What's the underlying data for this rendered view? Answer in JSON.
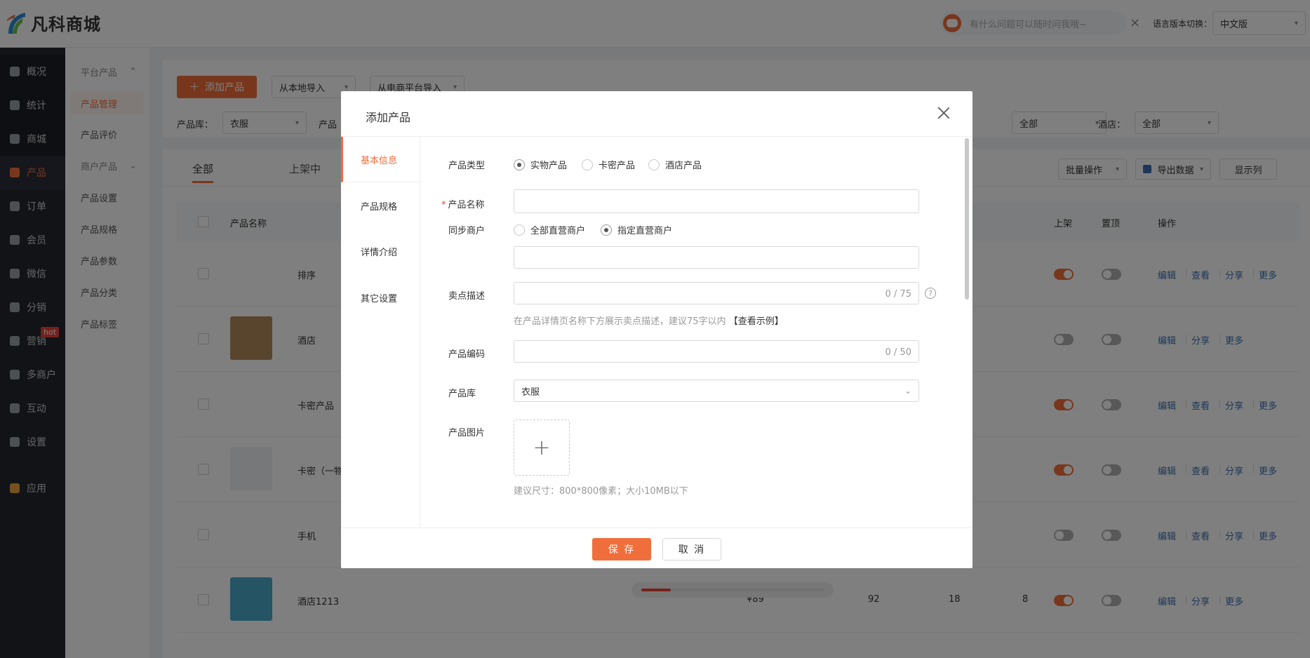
{
  "header": {
    "app_name": "凡科商城",
    "assistant_placeholder": "有什么问题可以随时问我哦~",
    "assistant_close": "×",
    "lang_label": "语言版本切换：",
    "lang_value": "中文版"
  },
  "sidebar": {
    "items": [
      {
        "label": "概况",
        "icon": "layers-icon"
      },
      {
        "label": "统计",
        "icon": "chart-icon"
      },
      {
        "label": "商城",
        "icon": "store-icon"
      },
      {
        "label": "产品",
        "icon": "grid-icon"
      },
      {
        "label": "订单",
        "icon": "order-icon"
      },
      {
        "label": "会员",
        "icon": "crown-icon"
      },
      {
        "label": "微信",
        "icon": "wechat-icon"
      },
      {
        "label": "分销",
        "icon": "distribution-icon"
      },
      {
        "label": "营销",
        "icon": "flag-icon",
        "badge": "hot"
      },
      {
        "label": "多商户",
        "icon": "merchant-icon"
      },
      {
        "label": "互动",
        "icon": "interact-icon"
      },
      {
        "label": "设置",
        "icon": "gear-icon"
      },
      {
        "label": "应用",
        "icon": "apps-icon"
      }
    ]
  },
  "subsidebar": {
    "items": [
      {
        "label": "平台产品",
        "group": true
      },
      {
        "label": "产品管理"
      },
      {
        "label": "产品评价"
      },
      {
        "label": "商户产品",
        "group": true
      },
      {
        "label": "产品设置"
      },
      {
        "label": "产品规格"
      },
      {
        "label": "产品参数"
      },
      {
        "label": "产品分类"
      },
      {
        "label": "产品标签"
      }
    ]
  },
  "toolbar": {
    "add_product": "添加产品",
    "import_local": "从本地导入",
    "import_platform": "从电商平台导入",
    "filter_lib_label": "产品库：",
    "filter_lib_value": "衣服",
    "filter_cut_label": "产品",
    "filter_a_value": "全部",
    "filter_hotel_label": "酒店：",
    "filter_hotel_value": "全部"
  },
  "table": {
    "tabs": [
      "全部",
      "上架中"
    ],
    "batch": "批量操作",
    "export": "导出数据",
    "show_columns": "显示列",
    "headers": {
      "name": "产品名称",
      "shelf": "上架",
      "pin": "置顶",
      "ops": "操作"
    },
    "rows": [
      {
        "name": "排序",
        "shelf": true,
        "pin": false,
        "ops": [
          "编辑",
          "查看",
          "分享",
          "更多"
        ]
      },
      {
        "name": "酒店",
        "shelf": false,
        "pin": false,
        "ops": [
          "编辑",
          "分享",
          "更多"
        ]
      },
      {
        "name": "卡密产品",
        "shelf": true,
        "pin": false,
        "ops": [
          "编辑",
          "查看",
          "分享",
          "更多"
        ]
      },
      {
        "name": "卡密（一物一码",
        "shelf": true,
        "pin": false,
        "ops": [
          "编辑",
          "查看",
          "分享",
          "更多"
        ]
      },
      {
        "name": "手机",
        "shelf": false,
        "pin": false,
        "ops": [
          "编辑",
          "查看",
          "分享",
          "更多"
        ]
      },
      {
        "name": "酒店1213",
        "price": "¥89",
        "c1": "92",
        "c2": "18",
        "c3": "8",
        "shelf": true,
        "pin": false,
        "ops": [
          "编辑",
          "分享",
          "更多"
        ]
      }
    ]
  },
  "modal": {
    "title": "添加产品",
    "nav": [
      "基本信息",
      "产品规格",
      "详情介绍",
      "其它设置"
    ],
    "fields": {
      "type_label": "产品类型",
      "type_options": [
        "实物产品",
        "卡密产品",
        "酒店产品"
      ],
      "type_selected": "实物产品",
      "name_label": "产品名称",
      "name_required": "*",
      "name_value": "",
      "sync_label": "同步商户",
      "sync_options": [
        "全部直营商户",
        "指定直营商户"
      ],
      "sync_selected": "指定直营商户",
      "sync_value": "",
      "selling_label": "卖点描述",
      "selling_counter": "0 / 75",
      "selling_help": "?",
      "selling_hint": "在产品详情页名称下方展示卖点描述，建议75字以内",
      "selling_hint_link": "【查看示例】",
      "code_label": "产品编码",
      "code_counter": "0 / 50",
      "lib_label": "产品库",
      "lib_value": "衣服",
      "image_label": "产品图片",
      "image_plus": "+",
      "image_hint": "建议尺寸：800*800像素；大小10MB以下"
    },
    "save": "保 存",
    "cancel": "取 消"
  },
  "progress": {
    "value": 0.16
  },
  "colors": {
    "accent": "#f06e3b",
    "link": "#3a6fb0",
    "sidebar_bg": "#23262e"
  }
}
